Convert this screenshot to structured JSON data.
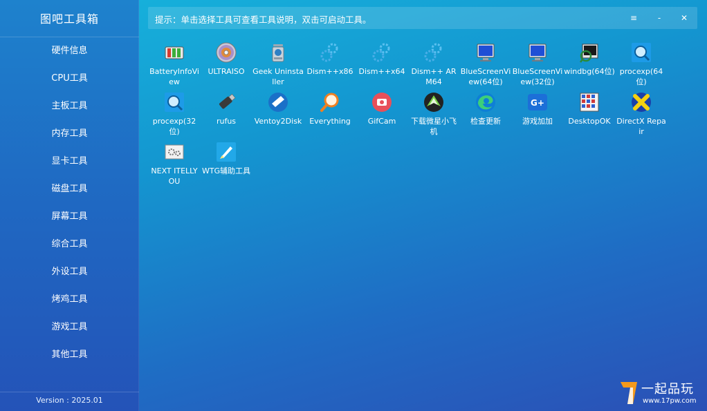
{
  "app": {
    "title": "图吧工具箱",
    "version": "Version : 2025.01"
  },
  "sidebar": {
    "items": [
      {
        "label": "硬件信息"
      },
      {
        "label": "CPU工具"
      },
      {
        "label": "主板工具"
      },
      {
        "label": "内存工具"
      },
      {
        "label": "显卡工具"
      },
      {
        "label": "磁盘工具"
      },
      {
        "label": "屏幕工具"
      },
      {
        "label": "综合工具"
      },
      {
        "label": "外设工具"
      },
      {
        "label": "烤鸡工具"
      },
      {
        "label": "游戏工具"
      },
      {
        "label": "其他工具"
      }
    ]
  },
  "topbar": {
    "hint": "提示：单击选择工具可查看工具说明，双击可启动工具。",
    "menu_icon": "≡",
    "minimize_icon": "-",
    "close_icon": "✕"
  },
  "tools": [
    {
      "label": "BatteryInfoView",
      "icon": "battery-icon"
    },
    {
      "label": "ULTRAISO",
      "icon": "disc-icon"
    },
    {
      "label": "Geek Uninstaller",
      "icon": "trash-can-icon"
    },
    {
      "label": "Dism++x86",
      "icon": "gears-icon"
    },
    {
      "label": "Dism++x64",
      "icon": "gears-icon"
    },
    {
      "label": "Dism++ ARM64",
      "icon": "gears-icon"
    },
    {
      "label": "BlueScreenView(64位)",
      "icon": "monitor-icon"
    },
    {
      "label": "BlueScreenView(32位)",
      "icon": "monitor-icon"
    },
    {
      "label": "windbg(64位)",
      "icon": "debugger-icon"
    },
    {
      "label": "procexp(64位)",
      "icon": "process-explorer-icon"
    },
    {
      "label": "procexp(32位)",
      "icon": "process-explorer-icon"
    },
    {
      "label": "rufus",
      "icon": "usb-drive-icon"
    },
    {
      "label": "Ventoy2Disk",
      "icon": "ventoy-icon"
    },
    {
      "label": "Everything",
      "icon": "magnifier-icon"
    },
    {
      "label": "GifCam",
      "icon": "camera-icon"
    },
    {
      "label": "下载微星小飞机",
      "icon": "afterburner-icon"
    },
    {
      "label": "检查更新",
      "icon": "edge-icon"
    },
    {
      "label": "游戏加加",
      "icon": "game-plus-icon"
    },
    {
      "label": "DesktopOK",
      "icon": "desktop-grid-icon"
    },
    {
      "label": "DirectX Repair",
      "icon": "directx-icon"
    },
    {
      "label": "NEXT ITELLYOU",
      "icon": "settings-window-icon"
    },
    {
      "label": "WTG辅助工具",
      "icon": "rocket-icon"
    }
  ],
  "watermark": {
    "text": "一起品玩",
    "url": "www.17pw.com",
    "logo_icon": "17pw-logo-icon"
  },
  "colors": {
    "background_top": "#17b5dd",
    "background_bottom": "#2b50b6",
    "sidebar": "#1f68c2",
    "text": "#ffffff"
  }
}
